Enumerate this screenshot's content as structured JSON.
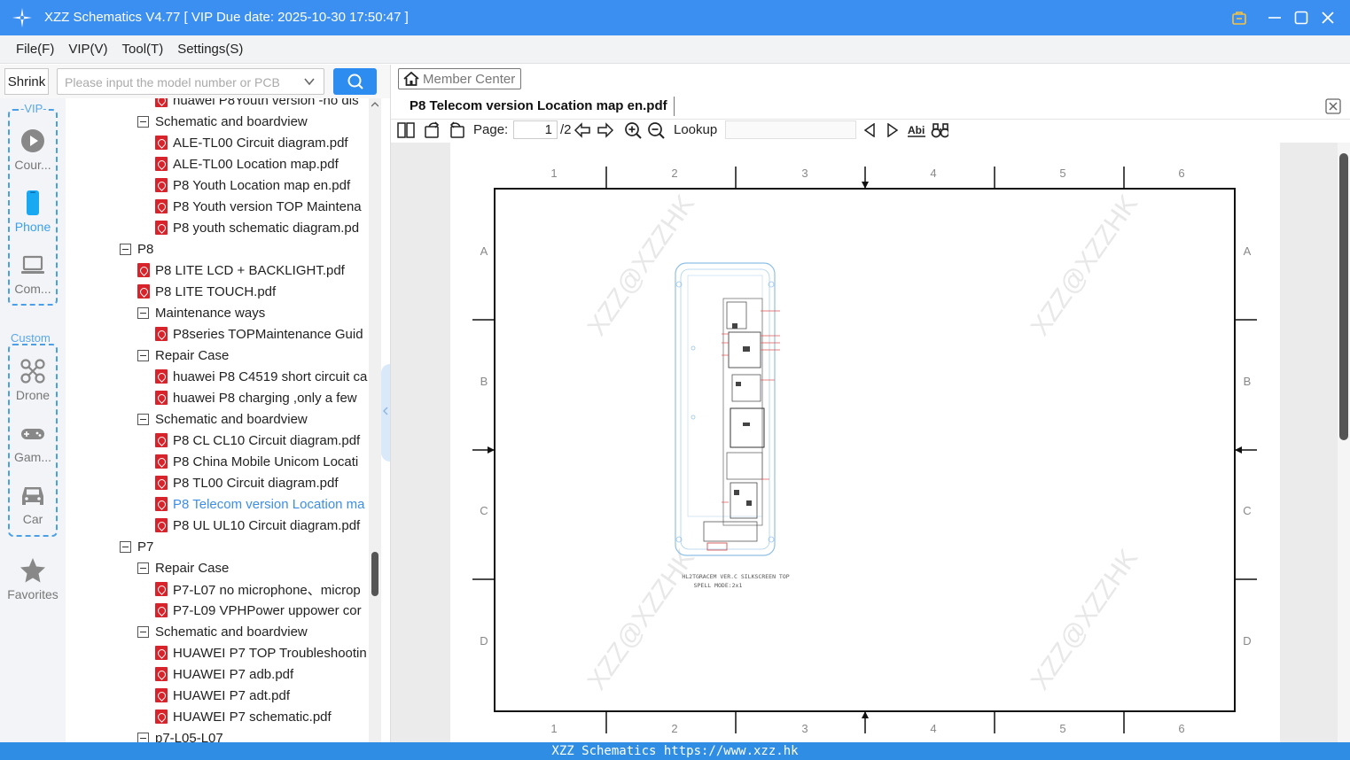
{
  "window": {
    "title": "XZZ Schematics V4.77 [ VIP Due date: 2025-10-30 17:50:47 ]",
    "accent_color": "#3b8ff0"
  },
  "menu": [
    "File(F)",
    "VIP(V)",
    "Tool(T)",
    "Settings(S)"
  ],
  "search": {
    "shrink_label": "Shrink",
    "placeholder": "Please input the model number or PCB",
    "value": ""
  },
  "rail": {
    "vip_label": "-VIP-",
    "custom_label": "Custom",
    "items": [
      {
        "label": "Cour...",
        "icon": "play-icon"
      },
      {
        "label": "Phone",
        "icon": "phone-icon"
      },
      {
        "label": "Com...",
        "icon": "laptop-icon"
      },
      {
        "label": "Drone",
        "icon": "drone-icon"
      },
      {
        "label": "Gam...",
        "icon": "gamepad-icon"
      },
      {
        "label": "Car",
        "icon": "car-icon"
      },
      {
        "label": "Favorites",
        "icon": "star-icon"
      }
    ]
  },
  "tree": [
    {
      "label": "huawei P8Youth version -no dis",
      "type": "file",
      "level": 2
    },
    {
      "label": "Schematic and boardview",
      "type": "folder",
      "level": 1
    },
    {
      "label": "ALE-TL00 Circuit diagram.pdf",
      "type": "file",
      "level": 2
    },
    {
      "label": "ALE-TL00 Location map.pdf",
      "type": "file",
      "level": 2
    },
    {
      "label": "P8 Youth Location map en.pdf",
      "type": "file",
      "level": 2
    },
    {
      "label": "P8 Youth version TOP Maintena",
      "type": "file",
      "level": 2
    },
    {
      "label": "P8 youth schematic diagram.pd",
      "type": "file",
      "level": 2
    },
    {
      "label": "P8",
      "type": "folder",
      "level": 0
    },
    {
      "label": "P8 LITE LCD + BACKLIGHT.pdf",
      "type": "file",
      "level": 1
    },
    {
      "label": "P8 LITE TOUCH.pdf",
      "type": "file",
      "level": 1
    },
    {
      "label": "Maintenance ways",
      "type": "folder",
      "level": 1
    },
    {
      "label": "P8series TOPMaintenance Guid",
      "type": "file",
      "level": 2
    },
    {
      "label": "Repair Case",
      "type": "folder",
      "level": 1
    },
    {
      "label": "huawei P8 C4519 short circuit ca",
      "type": "file",
      "level": 2
    },
    {
      "label": "huawei P8 charging ,only a few",
      "type": "file",
      "level": 2
    },
    {
      "label": "Schematic and boardview",
      "type": "folder",
      "level": 1
    },
    {
      "label": "P8 CL CL10 Circuit diagram.pdf",
      "type": "file",
      "level": 2
    },
    {
      "label": "P8 China Mobile Unicom Locati",
      "type": "file",
      "level": 2
    },
    {
      "label": "P8 TL00 Circuit diagram.pdf",
      "type": "file",
      "level": 2
    },
    {
      "label": "P8 Telecom version Location ma",
      "type": "file",
      "level": 2,
      "selected": true
    },
    {
      "label": "P8 UL UL10 Circuit diagram.pdf",
      "type": "file",
      "level": 2
    },
    {
      "label": "P7",
      "type": "folder",
      "level": 0
    },
    {
      "label": "Repair Case",
      "type": "folder",
      "level": 1
    },
    {
      "label": "P7-L07 no microphone、microp",
      "type": "file",
      "level": 2
    },
    {
      "label": "P7-L09 VPHPower uppower cor",
      "type": "file",
      "level": 2
    },
    {
      "label": "Schematic and boardview",
      "type": "folder",
      "level": 1
    },
    {
      "label": "HUAWEI P7 TOP Troubleshootin",
      "type": "file",
      "level": 2
    },
    {
      "label": "HUAWEI P7 adb.pdf",
      "type": "file",
      "level": 2
    },
    {
      "label": "HUAWEI P7 adt.pdf",
      "type": "file",
      "level": 2
    },
    {
      "label": "HUAWEI P7 schematic.pdf",
      "type": "file",
      "level": 2
    },
    {
      "label": "p7-L05-L07",
      "type": "folder",
      "level": 1
    }
  ],
  "viewer": {
    "member_center": "Member Center",
    "doc_tab": "P8 Telecom version Location map en.pdf",
    "page_label": "Page:",
    "current_page": "1",
    "total_pages": "/2",
    "lookup_label": "Lookup",
    "lookup_value": ""
  },
  "drawing": {
    "col_labels": [
      "1",
      "2",
      "3",
      "4",
      "5",
      "6"
    ],
    "row_labels": [
      "A",
      "B",
      "C",
      "D"
    ],
    "caption_line1": "HL2TGRACEM VER.C SILKSCREEN TOP",
    "caption_line2": "SPELL MODE:2x1",
    "watermark": "XZZ@XZZHK"
  },
  "footer": "XZZ Schematics https://www.xzz.hk"
}
